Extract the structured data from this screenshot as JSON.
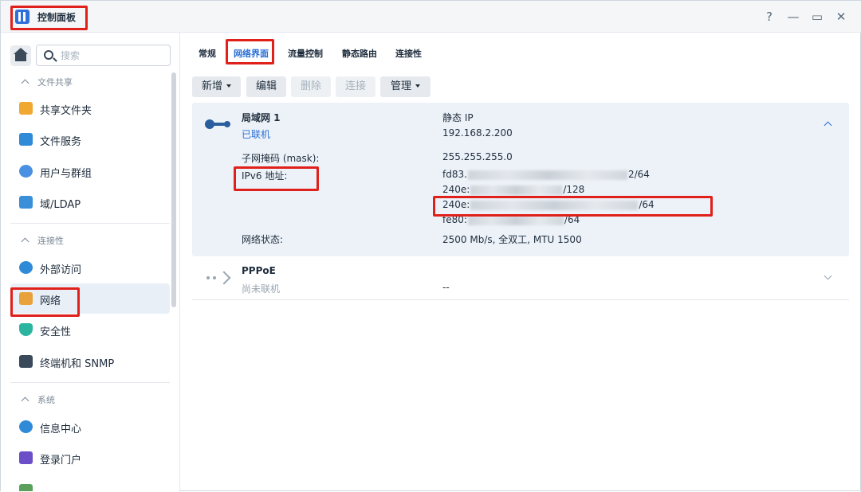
{
  "window": {
    "title": "控制面板",
    "help": "?",
    "minimize": "—",
    "maximize": "▭",
    "close": "✕"
  },
  "sidebar": {
    "search_placeholder": "搜索",
    "sections": [
      {
        "label": "文件共享",
        "items": [
          "共享文件夹",
          "文件服务",
          "用户与群组",
          "域/LDAP"
        ]
      },
      {
        "label": "连接性",
        "items": [
          "外部访问",
          "网络",
          "安全性",
          "终端机和 SNMP"
        ]
      },
      {
        "label": "系统",
        "items": [
          "信息中心",
          "登录门户"
        ]
      }
    ],
    "active_item": "网络"
  },
  "tabs": [
    "常规",
    "网络界面",
    "流量控制",
    "静态路由",
    "连接性"
  ],
  "active_tab": "网络界面",
  "toolbar": {
    "create": "新增",
    "edit": "编辑",
    "delete": "删除",
    "connect": "连接",
    "manage": "管理"
  },
  "interfaces": [
    {
      "name": "局域网 1",
      "status": "已联机",
      "ip_mode": "静态 IP",
      "ip": "192.168.2.200",
      "mask_label": "子网掩码 (mask):",
      "mask": "255.255.255.0",
      "ipv6_label": "IPv6 地址:",
      "ipv6": [
        {
          "prefix": "fd83.",
          "suffix": "2/64"
        },
        {
          "prefix": "240e:",
          "suffix": "/128"
        },
        {
          "prefix": "240e:",
          "suffix": "/64"
        },
        {
          "prefix": "fe80:",
          "suffix": "/64"
        }
      ],
      "net_status_label": "网络状态:",
      "net_status": "2500 Mb/s, 全双工, MTU 1500"
    },
    {
      "name": "PPPoE",
      "status": "尚未联机",
      "value": "--"
    }
  ],
  "colors": {
    "accent": "#2a6fd6",
    "highlight": "#e0201b",
    "panel": "#edf2f8"
  }
}
